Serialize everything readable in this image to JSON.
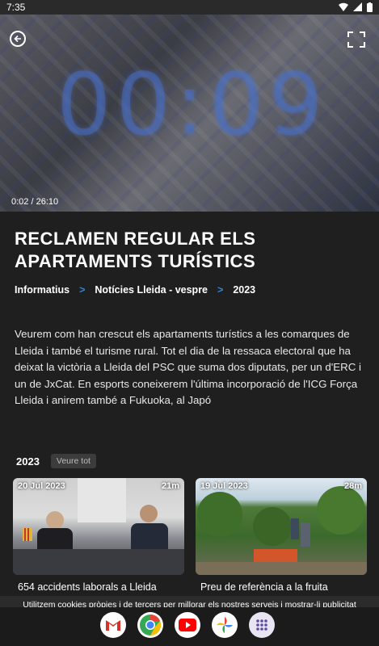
{
  "status_bar": {
    "time": "7:35"
  },
  "player": {
    "overlay_counter": "00:09",
    "time_label": "0:02 / 26:10",
    "progress": 0.0013
  },
  "program": {
    "title": "RECLAMEN REGULAR ELS APARTAMENTS TURÍSTICS",
    "breadcrumb": [
      "Informatius",
      "Notícies Lleida - vespre",
      "2023"
    ],
    "separator": ">",
    "description": "Veurem com han crescut els apartaments turístics a les comarques de Lleida i també el turisme rural. Tot el dia de la ressaca electoral que ha deixat la victòria a Lleida del PSC que suma dos diputats, per un d'ERC i un de JxCat. En esports coneixerem l'última incorporació de l'ICG Força Lleida i anirem també a Fukuoka, al Japó"
  },
  "section": {
    "year": "2023",
    "see_all": "Veure tot",
    "cards": [
      {
        "date": "20 Jul 2023",
        "duration": "21m",
        "caption": "654 accidents laborals a Lleida"
      },
      {
        "date": "19 Jul 2023",
        "duration": "28m",
        "caption": "Preu de referència a la fruita"
      }
    ]
  },
  "cookie_banner": "Utilitzem cookies pròpies i de tercers per millorar els nostres serveis i mostrar-li publicitat",
  "dock": {
    "apps": [
      "gmail-icon",
      "chrome-icon",
      "youtube-icon",
      "photos-icon",
      "app-drawer-icon"
    ]
  },
  "colors": {
    "accent": "#e07a18",
    "breadcrumb_sep": "#2d86d6",
    "background": "#1f1f1f"
  }
}
